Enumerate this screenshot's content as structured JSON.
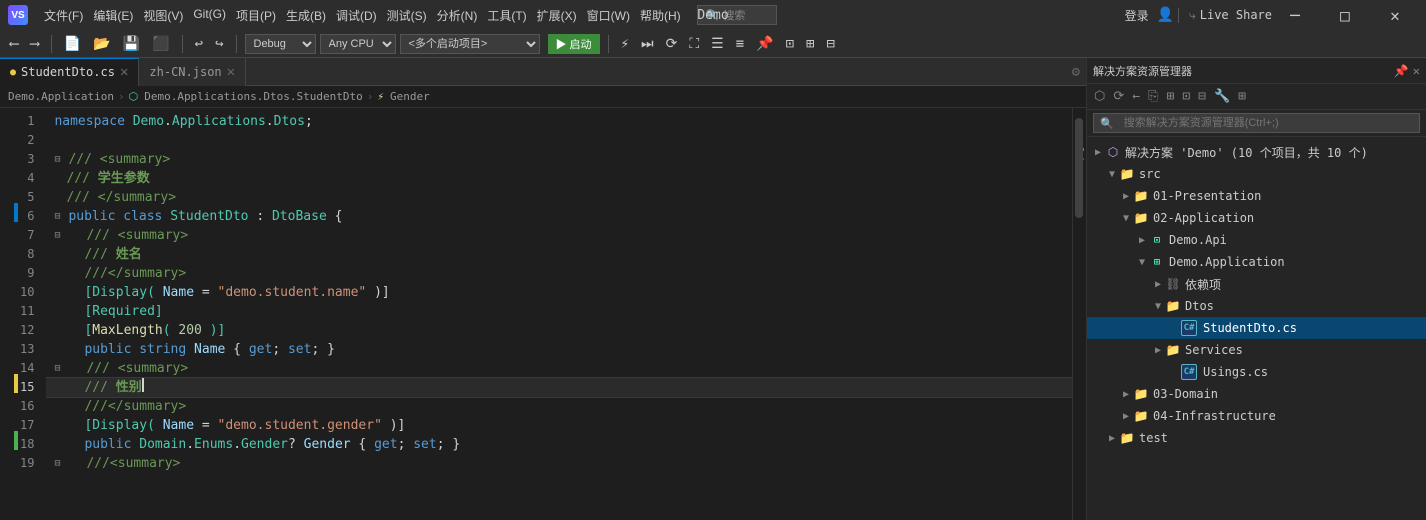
{
  "titlebar": {
    "logo": "VS",
    "menus": [
      "文件(F)",
      "编辑(E)",
      "视图(V)",
      "Git(G)",
      "项目(P)",
      "生成(B)",
      "调试(D)",
      "测试(S)",
      "分析(N)",
      "工具(T)",
      "扩展(X)",
      "窗口(W)",
      "帮助(H)"
    ],
    "search_placeholder": "搜索",
    "app_title": "Demo",
    "sign_in": "登录",
    "live_share": "Live Share",
    "min_btn": "─",
    "max_btn": "□",
    "close_btn": "✕"
  },
  "toolbar": {
    "debug_config": "Debug",
    "platform": "Any CPU",
    "startup": "<多个启动项目>",
    "run_label": "▶ 启动",
    "separator": "|"
  },
  "tabs": {
    "tab1_label": "StudentDto.cs",
    "tab1_modified": "●",
    "tab2_label": "zh-CN.json",
    "settings_icon": "⚙"
  },
  "breadcrumb": {
    "project": "Demo.Application",
    "class": "Demo.Applications.Dtos.StudentDto",
    "member": "Gender"
  },
  "code": {
    "lines": [
      {
        "num": 1,
        "content": "namespace Demo.Applications.Dtos;",
        "type": "ns"
      },
      {
        "num": 2,
        "content": "",
        "type": "empty"
      },
      {
        "num": 3,
        "content": "⊟/// <summary>",
        "type": "comment"
      },
      {
        "num": 4,
        "content": "/// 学生参数",
        "type": "comment"
      },
      {
        "num": 5,
        "content": "/// </summary>",
        "type": "comment"
      },
      {
        "num": 6,
        "content": "⊟public class StudentDto : DtoBase {",
        "type": "class"
      },
      {
        "num": 7,
        "content": "⊟    /// <summary>",
        "type": "comment"
      },
      {
        "num": 8,
        "content": "    /// 姓名",
        "type": "comment"
      },
      {
        "num": 9,
        "content": "    ///</summary>",
        "type": "comment"
      },
      {
        "num": 10,
        "content": "    [Display( Name = ＂demo.student.name＂ )]",
        "type": "attr"
      },
      {
        "num": 11,
        "content": "    [Required]",
        "type": "attr"
      },
      {
        "num": 12,
        "content": "    [MaxLength( 200 )]",
        "type": "attr"
      },
      {
        "num": 13,
        "content": "    public string Name { get; set; }",
        "type": "prop"
      },
      {
        "num": 14,
        "content": "⊟    /// <summary>",
        "type": "comment"
      },
      {
        "num": 15,
        "content": "    /// 性别",
        "type": "comment-current"
      },
      {
        "num": 16,
        "content": "    ///</summary>",
        "type": "comment"
      },
      {
        "num": 17,
        "content": "    [Display( Name = ＂demo.student.gender＂ )]",
        "type": "attr"
      },
      {
        "num": 18,
        "content": "    public Domain.Enums.Gender? Gender { get; set; }",
        "type": "prop"
      },
      {
        "num": 19,
        "content": "⊟    ///<summary>",
        "type": "comment"
      }
    ]
  },
  "solution_explorer": {
    "title": "解决方案资源管理器",
    "search_placeholder": "搜索解决方案资源管理器(Ctrl+;)",
    "root_label": "解决方案 'Demo' (10 个项目，共 10 个)",
    "tree": [
      {
        "id": "src",
        "label": "src",
        "level": 1,
        "type": "folder",
        "expanded": true
      },
      {
        "id": "01-Presentation",
        "label": "01-Presentation",
        "level": 2,
        "type": "folder",
        "expanded": false
      },
      {
        "id": "02-Application",
        "label": "02-Application",
        "level": 2,
        "type": "folder",
        "expanded": true
      },
      {
        "id": "Demo.Api",
        "label": "Demo.Api",
        "level": 3,
        "type": "project",
        "expanded": false
      },
      {
        "id": "Demo.Application",
        "label": "Demo.Application",
        "level": 3,
        "type": "project",
        "expanded": true
      },
      {
        "id": "deps",
        "label": "依赖项",
        "level": 4,
        "type": "deps",
        "expanded": false
      },
      {
        "id": "Dtos",
        "label": "Dtos",
        "level": 4,
        "type": "folder",
        "expanded": true
      },
      {
        "id": "StudentDto.cs",
        "label": "StudentDto.cs",
        "level": 5,
        "type": "cs",
        "expanded": false,
        "selected": true
      },
      {
        "id": "Services",
        "label": "Services",
        "level": 4,
        "type": "folder",
        "expanded": false
      },
      {
        "id": "Usings.cs",
        "label": "Usings.cs",
        "level": 5,
        "type": "cs",
        "expanded": false
      },
      {
        "id": "03-Domain",
        "label": "03-Domain",
        "level": 2,
        "type": "folder",
        "expanded": false
      },
      {
        "id": "04-Infrastructure",
        "label": "04-Infrastructure",
        "level": 2,
        "type": "folder",
        "expanded": false
      },
      {
        "id": "test",
        "label": "test",
        "level": 1,
        "type": "folder",
        "expanded": false
      }
    ]
  }
}
